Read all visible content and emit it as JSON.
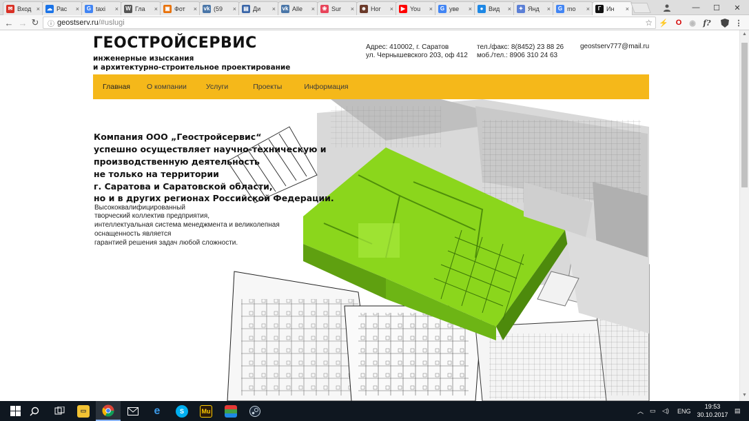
{
  "browser": {
    "tabs": [
      {
        "label": "Вход",
        "color": "#d93025",
        "glyph": "✉"
      },
      {
        "label": "Рас",
        "color": "#1a73e8",
        "glyph": "☁"
      },
      {
        "label": "taxi",
        "color": "#4285f4",
        "glyph": "G"
      },
      {
        "label": "Гла",
        "color": "#555555",
        "glyph": "W"
      },
      {
        "label": "Фот",
        "color": "#e8710a",
        "glyph": "▣"
      },
      {
        "label": "(59",
        "color": "#4a76a8",
        "glyph": "vk"
      },
      {
        "label": "Ди",
        "color": "#3a66a8",
        "glyph": "▤"
      },
      {
        "label": "Alle",
        "color": "#4a76a8",
        "glyph": "vk"
      },
      {
        "label": "Sur",
        "color": "#e8445a",
        "glyph": "❀"
      },
      {
        "label": "Ног",
        "color": "#6b3a2a",
        "glyph": "☻"
      },
      {
        "label": "You",
        "color": "#ff0000",
        "glyph": "▶"
      },
      {
        "label": "уве",
        "color": "#4285f4",
        "glyph": "G"
      },
      {
        "label": "Вид",
        "color": "#1e88e5",
        "glyph": "●"
      },
      {
        "label": "Янд",
        "color": "#5b7fd6",
        "glyph": "✦"
      },
      {
        "label": "mo",
        "color": "#4285f4",
        "glyph": "G"
      },
      {
        "label": "Ин",
        "color": "#111111",
        "glyph": "Г",
        "active": true
      }
    ],
    "url_host": "geostserv.ru",
    "url_path": "/#uslugi",
    "controls": {
      "minimize": "—",
      "maximize": "☐",
      "close": "✕"
    }
  },
  "site": {
    "brand": "ГЕОСТРОЙСЕРВИС",
    "tagline1": "инженерные изыскания",
    "tagline2": "и архитектурно-строительное проектирование",
    "address1": "Адрес: 410002, г. Саратов",
    "address2": "ул. Чернышевского 203, оф 412",
    "phone1": "тел./факс:  8(8452) 23 88 26",
    "phone2": "моб./тел.: 8906 310 24 63",
    "email": "geostserv777@mail.ru",
    "menu": [
      "Главная",
      "О компании",
      "Услуги",
      "Проекты",
      "Информация"
    ],
    "headline": [
      "Компания ООО „Геостройсервис“",
      "успешно осуществляет научно-техническую и",
      "производственную деятельность",
      " не только на территории",
      " г. Саратова и Саратовской области,",
      "но и в других регионах Российской Федерации."
    ],
    "description": [
      "Высококвалифицированный",
      "творческий коллектив предприятия,",
      "интеллектуальная система менеджмента и великолепная",
      "оснащенность является",
      "гарантией решения задач любой сложности."
    ]
  },
  "taskbar": {
    "language": "ENG",
    "time": "19:53",
    "date": "30.10.2017"
  },
  "colors": {
    "menu_bg": "#f5b81a",
    "accent_green": "#8bd61c",
    "taskbar_bg": "#0f1720"
  }
}
